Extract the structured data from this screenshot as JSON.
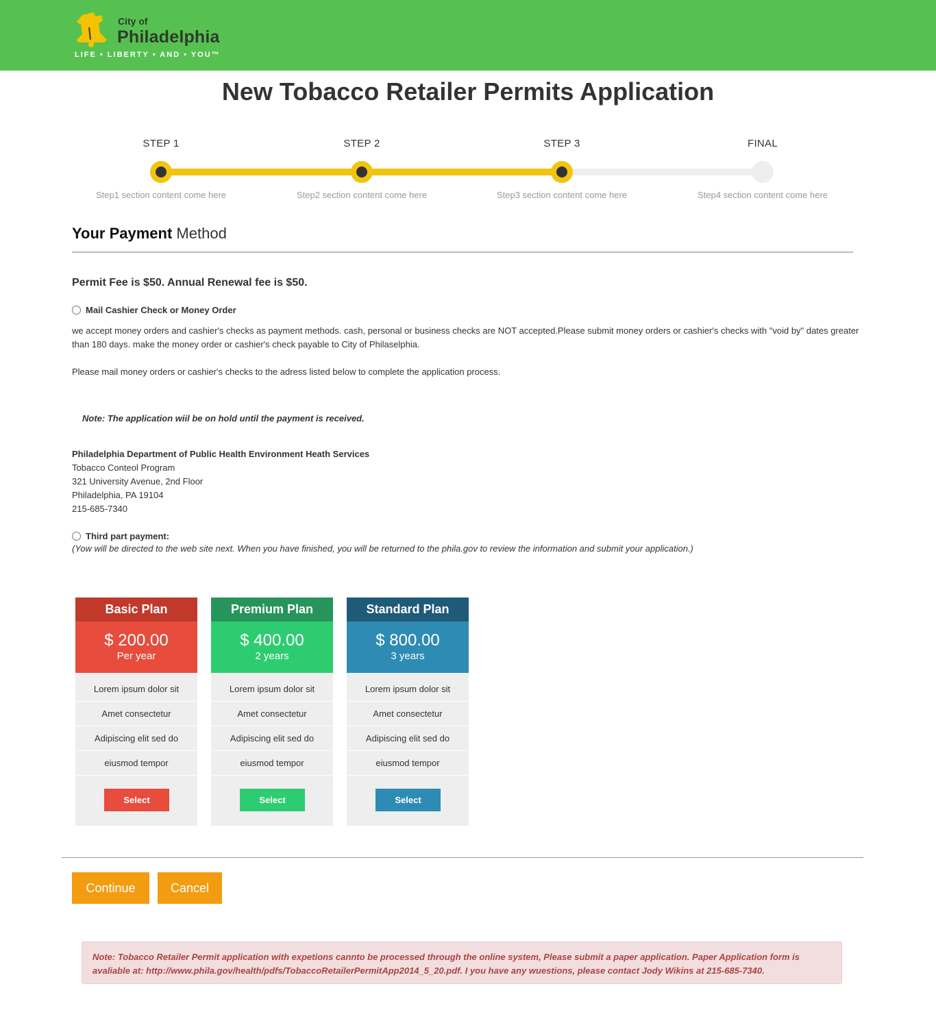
{
  "header": {
    "logo_city": "City of",
    "logo_name": "Philadelphia",
    "logo_tagline": "LIFE • LIBERTY • AND • YOU™",
    "bar_color": "#56c150"
  },
  "page_title": "New Tobacco Retailer Permits Application",
  "stepper": {
    "steps": [
      {
        "label": "STEP 1",
        "desc": "Step1 section content come here",
        "status": "done"
      },
      {
        "label": "STEP 2",
        "desc": "Step2 section content come here",
        "status": "done"
      },
      {
        "label": "STEP 3",
        "desc": "Step3 section content come here",
        "status": "done"
      },
      {
        "label": "FINAL",
        "desc": "Step4 section content come here",
        "status": "todo"
      }
    ],
    "progress_color": "#f1c40f"
  },
  "payment": {
    "title_bold": "Your Payment",
    "title_rest": " Method",
    "fee_text": "Permit Fee is $50. Annual Renewal fee is $50.",
    "option_mail": "Mail Cashier Check or Money Order",
    "mail_para1": "we accept money orders and cashier's checks as payment methods. cash, personal or business checks are NOT accepted.Please submit money orders or cashier's checks with \"void by\" dates greater than 180 days. make the money order or cashier's check payable to City of Philaselphia.",
    "mail_para2": "Please mail money orders or cashier's checks to the adress listed below to complete the application process.",
    "hold_note": "Note: The application wiil be on hold until the payment is received.",
    "address": {
      "org": "Philadelphia Department of Public Health Environment Heath Services",
      "program": "Tobacco Conteol Program",
      "street": "321 University Avenue, 2nd Floor",
      "city": "Philadelphia, PA 19104",
      "phone": "215-685-7340"
    },
    "option_third": "Third part payment:",
    "third_note": "(Yow will be directed to the web site next. When you have finished, you will be returned to the phila.gov to review the information and submit your application.)"
  },
  "plans": [
    {
      "name": "Basic Plan",
      "price": "$ 200.00",
      "period": "Per year",
      "features": [
        "Lorem ipsum dolor sit",
        "Amet consectetur",
        "Adipiscing elit  sed do",
        "eiusmod tempor"
      ],
      "button": "Select"
    },
    {
      "name": "Premium Plan",
      "price": "$ 400.00",
      "period": "2 years",
      "features": [
        "Lorem ipsum dolor sit",
        "Amet consectetur",
        "Adipiscing elit  sed do",
        "eiusmod tempor"
      ],
      "button": "Select"
    },
    {
      "name": "Standard Plan",
      "price": "$ 800.00",
      "period": "3 years",
      "features": [
        "Lorem ipsum dolor sit",
        "Amet consectetur",
        "Adipiscing elit  sed do",
        "eiusmod tempor"
      ],
      "button": "Select"
    }
  ],
  "actions": {
    "continue_label": "Continue",
    "cancel_label": "Cancel",
    "color": "#f39c12"
  },
  "alert_text": "Note: Tobacco Retailer Permit application with expetions cannto be processed through the online system, Please submit a paper application. Paper Application form is avaliable at: http://www.phila.gov/health/pdfs/TobaccoRetailerPermitApp2014_5_20.pdf. I you have any wuestions, please contact Jody Wikins at 215-685-7340."
}
